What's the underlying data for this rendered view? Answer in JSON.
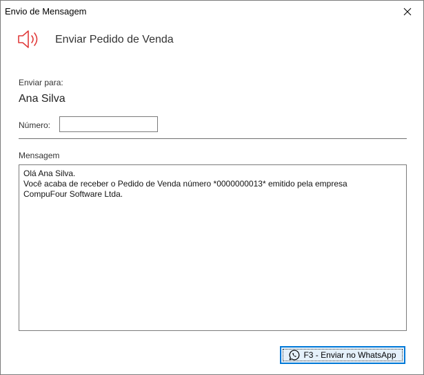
{
  "window": {
    "title": "Envio de Mensagem",
    "close_symbol": "✕"
  },
  "header": {
    "title": "Enviar Pedido de Venda",
    "icon": "speaker-icon",
    "icon_color": "#e03a3a"
  },
  "recipient": {
    "label": "Enviar para:",
    "name": "Ana Silva"
  },
  "numero": {
    "label": "Número:",
    "value": ""
  },
  "message": {
    "label": "Mensagem",
    "lines": [
      "Olá Ana Silva.",
      "Você acaba de receber o Pedido de Venda número *0000000013* emitido pela empresa",
      "CompuFour Software Ltda."
    ]
  },
  "actions": {
    "send_whatsapp_label": "F3 - Enviar no WhatsApp",
    "send_icon": "whatsapp-icon"
  }
}
